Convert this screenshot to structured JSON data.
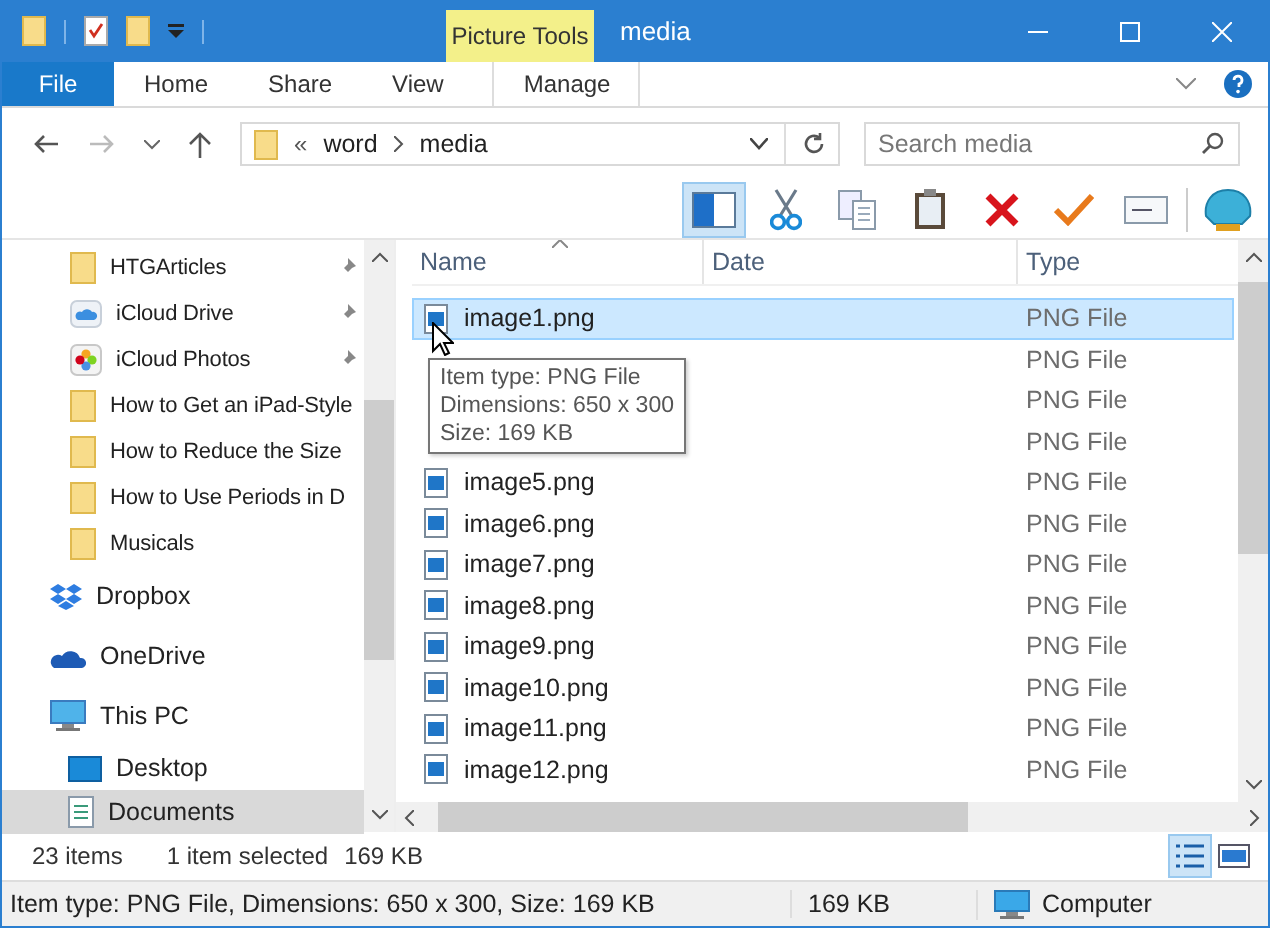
{
  "window": {
    "title": "media",
    "context_group": "Picture Tools"
  },
  "ribbon_tabs": [
    {
      "label": "File",
      "kind": "file",
      "selected": false
    },
    {
      "label": "Home",
      "kind": "tab",
      "selected": false
    },
    {
      "label": "Share",
      "kind": "tab",
      "selected": false
    },
    {
      "label": "View",
      "kind": "tab",
      "selected": false
    },
    {
      "label": "Manage",
      "kind": "context",
      "selected": false
    }
  ],
  "address": {
    "prefix": "«",
    "crumbs": [
      "word",
      "media"
    ]
  },
  "search": {
    "placeholder": "Search media"
  },
  "toolbar": [
    {
      "kind": "pane",
      "selected": true
    },
    {
      "kind": "cut",
      "selected": false
    },
    {
      "kind": "copy",
      "selected": false
    },
    {
      "kind": "paste",
      "selected": false
    },
    {
      "kind": "delete",
      "selected": false
    },
    {
      "kind": "check",
      "selected": false
    },
    {
      "kind": "rename",
      "selected": false
    },
    {
      "kind": "shell",
      "selected": false
    }
  ],
  "nav": {
    "quick_access": [
      {
        "label": "HTGArticles",
        "kind": "folder",
        "pinned": true
      },
      {
        "label": "iCloud Drive",
        "kind": "icloud",
        "pinned": true
      },
      {
        "label": "iCloud Photos",
        "kind": "photos",
        "pinned": true
      },
      {
        "label": "How to Get an iPad-Style",
        "kind": "folder",
        "pinned": false
      },
      {
        "label": "How to Reduce the Size",
        "kind": "folder",
        "pinned": false
      },
      {
        "label": "How to Use Periods in D",
        "kind": "folder",
        "pinned": false
      },
      {
        "label": "Musicals",
        "kind": "folder",
        "pinned": false
      }
    ],
    "items": [
      {
        "label": "Dropbox",
        "kind": "dropbox",
        "selected": false
      },
      {
        "label": "OneDrive",
        "kind": "onedrive",
        "selected": false
      },
      {
        "label": "This PC",
        "kind": "pc",
        "selected": false,
        "children": [
          {
            "label": "Desktop",
            "kind": "desktop",
            "selected": false
          },
          {
            "label": "Documents",
            "kind": "documents",
            "selected": true
          }
        ]
      }
    ]
  },
  "columns": [
    "Name",
    "Date",
    "Type"
  ],
  "files": [
    {
      "name": "image1.png",
      "type": "PNG File",
      "selected": true
    },
    {
      "type": "PNG File",
      "selected": false
    },
    {
      "type": "PNG File",
      "selected": false
    },
    {
      "type": "PNG File",
      "selected": false
    },
    {
      "name": "image5.png",
      "type": "PNG File",
      "selected": false
    },
    {
      "name": "image6.png",
      "type": "PNG File",
      "selected": false
    },
    {
      "name": "image7.png",
      "type": "PNG File",
      "selected": false
    },
    {
      "name": "image8.png",
      "type": "PNG File",
      "selected": false
    },
    {
      "name": "image9.png",
      "type": "PNG File",
      "selected": false
    },
    {
      "name": "image10.png",
      "type": "PNG File",
      "selected": false
    },
    {
      "name": "image11.png",
      "type": "PNG File",
      "selected": false
    },
    {
      "name": "image12.png",
      "type": "PNG File",
      "selected": false
    }
  ],
  "tooltip": [
    "Item type: PNG File",
    "Dimensions: 650 x 300",
    "Size: 169 KB"
  ],
  "status": {
    "count": "23 items",
    "selection": "1 item selected",
    "size": "169 KB",
    "views": [
      {
        "kind": "details",
        "selected": true
      },
      {
        "kind": "tiles",
        "selected": false
      }
    ]
  },
  "info_bar": {
    "text": "Item type: PNG File, Dimensions: 650 x 300, Size: 169 KB",
    "size": "169 KB",
    "location": "Computer"
  }
}
